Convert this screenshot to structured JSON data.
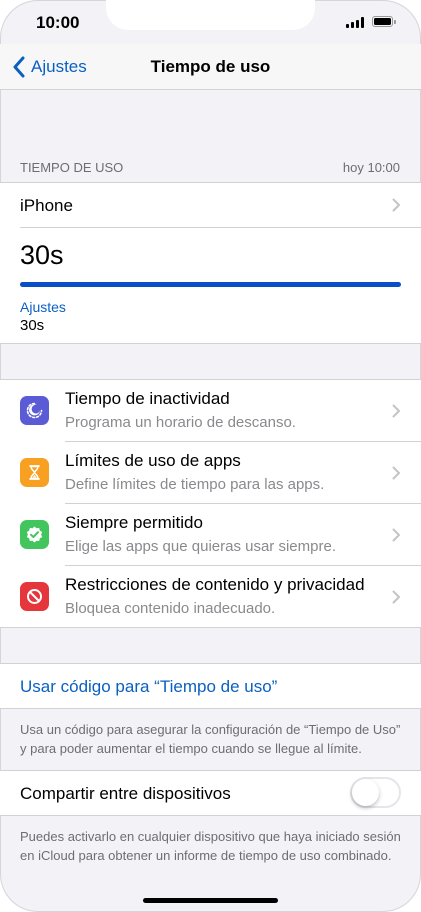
{
  "status_bar": {
    "time": "10:00"
  },
  "nav": {
    "back_label": "Ajustes",
    "title": "Tiempo de uso"
  },
  "summary": {
    "header_left": "TIEMPO DE USO",
    "header_right": "hoy 10:00",
    "device_label": "iPhone",
    "total": "30s",
    "usage_fraction": 1.0,
    "category": "Ajustes",
    "category_value": "30s"
  },
  "options": [
    {
      "title": "Tiempo de inactividad",
      "subtitle": "Programa un horario de descanso.",
      "icon": "downtime-icon",
      "color": "#5b5bd6"
    },
    {
      "title": "Límites de uso de apps",
      "subtitle": "Define límites de tiempo para las apps.",
      "icon": "hourglass-icon",
      "color": "#f7a022"
    },
    {
      "title": "Siempre permitido",
      "subtitle": "Elige las apps que quieras usar siempre.",
      "icon": "checkmark-badge-icon",
      "color": "#41c55c"
    },
    {
      "title": "Restricciones de contenido y privacidad",
      "subtitle": "Bloquea contenido inadecuado.",
      "icon": "restriction-icon",
      "color": "#e5363c"
    }
  ],
  "passcode": {
    "link_label": "Usar código para “Tiempo de uso”",
    "footer": "Usa un código para asegurar la configuración de “Tiempo de Uso” y para poder aumentar el tiempo cuando se llegue al límite."
  },
  "share": {
    "label": "Compartir entre dispositivos",
    "enabled": false,
    "footer": "Puedes activarlo en cualquier dispositivo que haya iniciado sesión en iCloud para obtener un informe de tiempo de uso combinado."
  },
  "colors": {
    "accent": "#0a60c2",
    "bar": "#0a4fc7"
  }
}
